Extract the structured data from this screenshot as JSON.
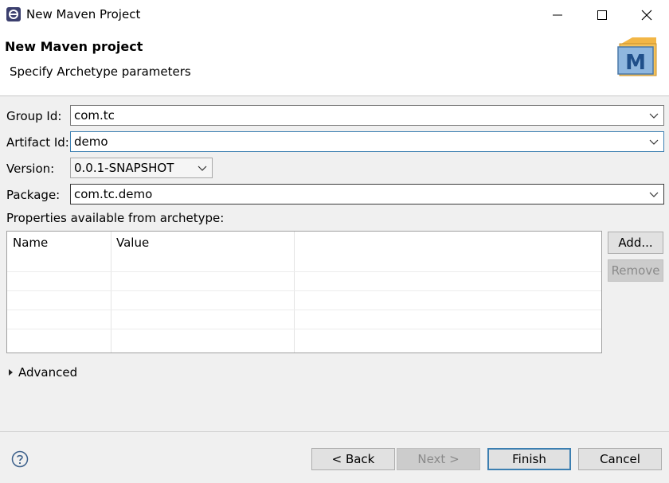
{
  "window": {
    "title": "New Maven Project",
    "icon": "eclipse-icon"
  },
  "header": {
    "title": "New Maven project",
    "subtitle": "Specify Archetype parameters",
    "logo_letter": "M"
  },
  "form": {
    "group_id": {
      "label": "Group Id:",
      "value": "com.tc"
    },
    "artifact_id": {
      "label": "Artifact Id:",
      "value": "demo"
    },
    "version": {
      "label": "Version:",
      "value": "0.0.1-SNAPSHOT"
    },
    "package": {
      "label": "Package:",
      "value": "com.tc.demo"
    }
  },
  "properties": {
    "label": "Properties available from archetype:",
    "columns": [
      "Name",
      "Value"
    ],
    "add_label": "Add...",
    "remove_label": "Remove"
  },
  "advanced": {
    "label": "Advanced"
  },
  "footer": {
    "back_label": "< Back",
    "next_label": "Next >",
    "finish_label": "Finish",
    "cancel_label": "Cancel"
  },
  "colors": {
    "focus_border": "#3c7fb1",
    "background": "#f0f0f0"
  }
}
